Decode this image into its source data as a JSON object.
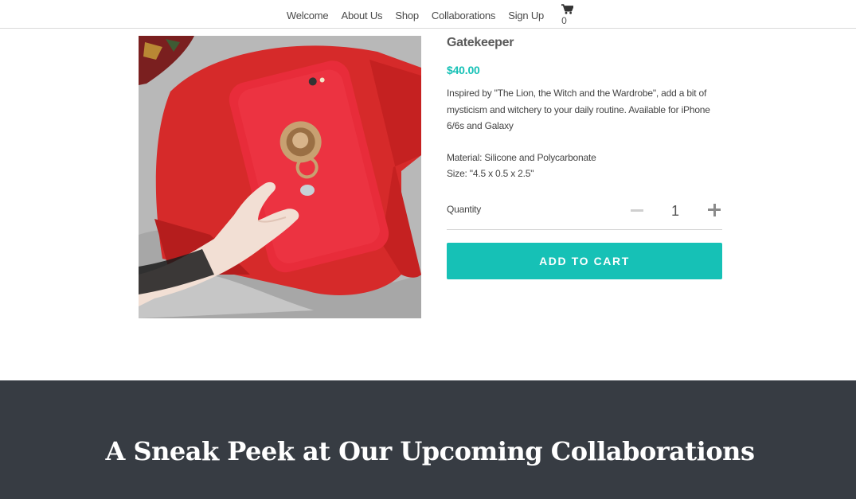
{
  "nav": {
    "items": [
      {
        "label": "Welcome"
      },
      {
        "label": "About Us"
      },
      {
        "label": "Shop"
      },
      {
        "label": "Collaborations"
      },
      {
        "label": "Sign Up"
      }
    ],
    "cart": {
      "icon": "cart-icon",
      "count": "0"
    }
  },
  "product": {
    "title": "Gatekeeper",
    "price": "$40.00",
    "description": "Inspired by \"The Lion, the Witch and the Wardrobe\", add a bit of mysticism and witchery to your daily routine. Available for iPhone 6/6s and Galaxy",
    "material": "Material: Silicone and Polycarbonate",
    "size": "Size: \"4.5 x 0.5 x 2.5\"",
    "quantity_label": "Quantity",
    "quantity_value": "1",
    "add_to_cart_label": "ADD TO CART"
  },
  "collab": {
    "heading": "A Sneak Peek at Our Upcoming Collaborations"
  },
  "colors": {
    "accent": "#16c1b6",
    "dark_band": "#373c43",
    "nav_border": "#d9d9d9"
  }
}
